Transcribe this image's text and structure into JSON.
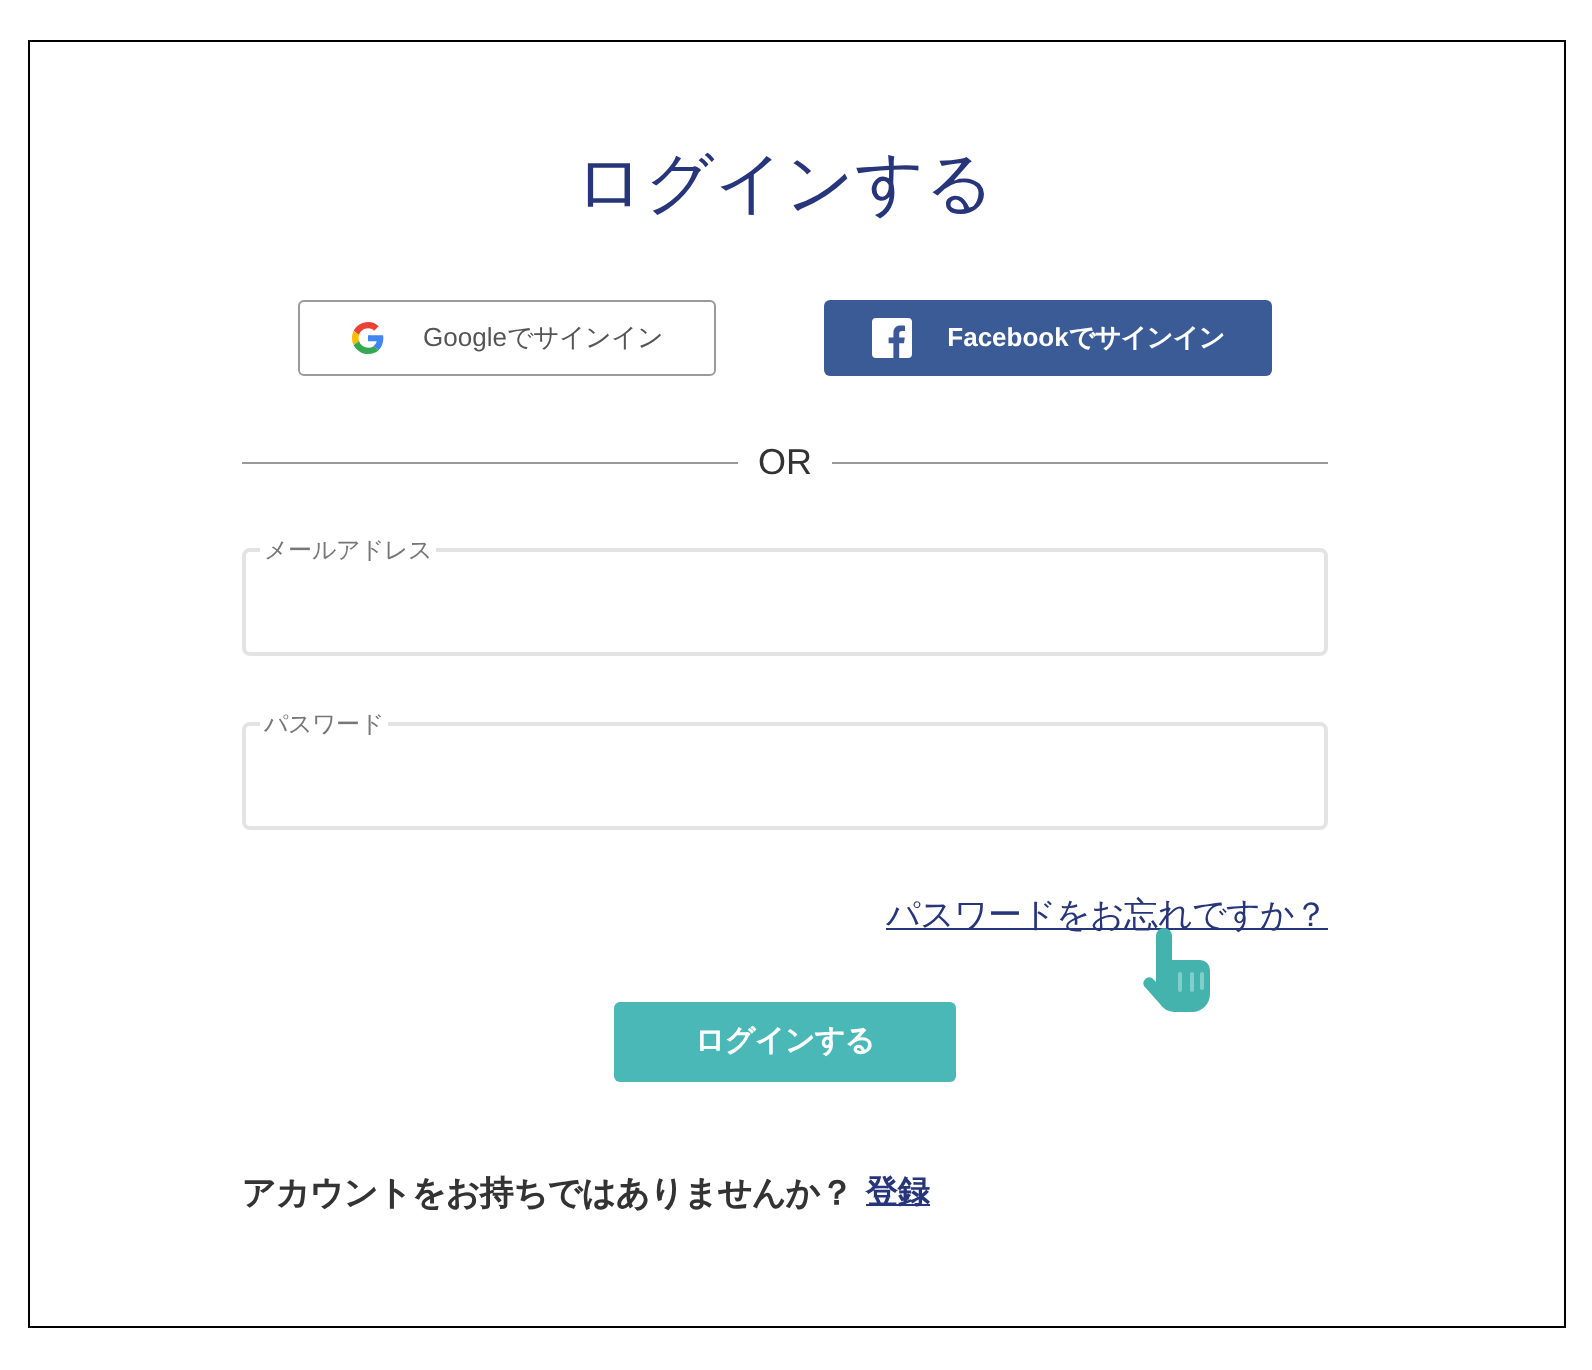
{
  "title": "ログインする",
  "social_buttons": [
    {
      "kind": "google",
      "label": "Googleでサインイン"
    },
    {
      "kind": "facebook",
      "label": "Facebookでサインイン"
    }
  ],
  "divider": {
    "label": "OR"
  },
  "fields": [
    {
      "label": "メールアドレス"
    },
    {
      "label": "パスワード"
    }
  ],
  "forgot_link": "パスワードをお忘れですか？",
  "submit_button": "ログインする",
  "signup": {
    "prompt": "アカウントをお持ちではありませんか？",
    "link": "登録"
  }
}
